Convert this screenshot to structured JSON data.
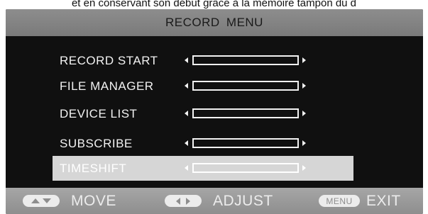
{
  "caption": "et en conservant son début grâce à la mémoire tampon du d",
  "menu": {
    "title": "RECORD  MENU",
    "items": [
      {
        "label": "RECORD START"
      },
      {
        "label": "FILE MANAGER"
      },
      {
        "label": "DEVICE LIST"
      },
      {
        "label": "SUBSCRIBE"
      },
      {
        "label": "TIMESHIFT"
      }
    ],
    "selected_item": "TIMESHIFT"
  },
  "footer": {
    "move_label": "MOVE",
    "adjust_label": "ADJUST",
    "menu_key_label": "MENU",
    "exit_label": "EXIT"
  },
  "colors": {
    "osd_background": "#101010",
    "title_bar": "#808080",
    "highlight": "#d6d6d6",
    "footer_bar": "#9a9a9a",
    "text": "#f2f2f2"
  }
}
